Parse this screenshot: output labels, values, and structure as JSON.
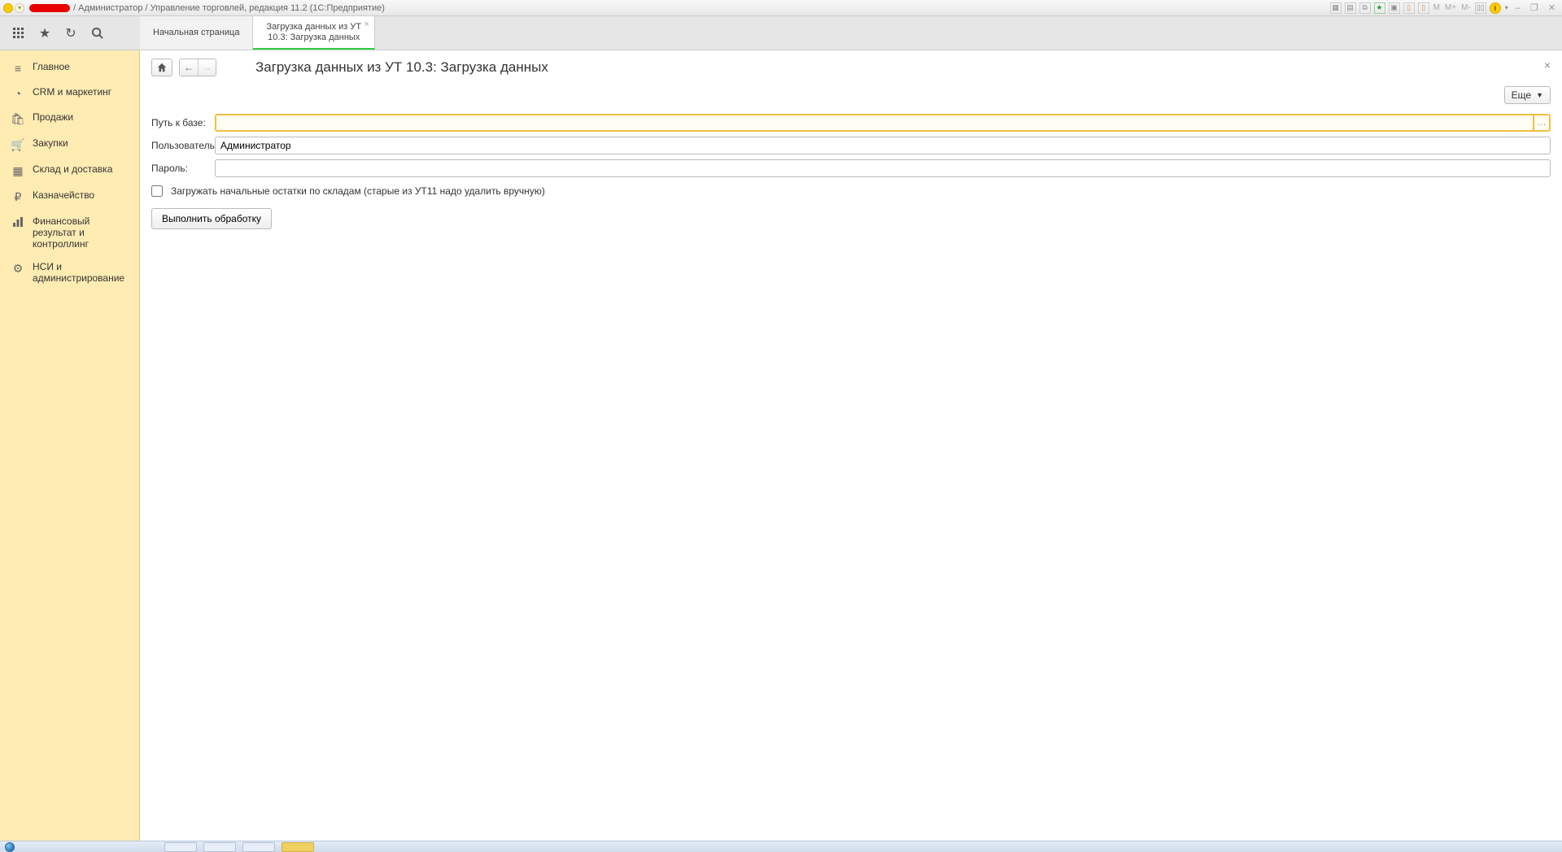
{
  "titlebar": {
    "text": "/ Администратор / Управление торговлей, редакция 11.2  (1С:Предприятие)",
    "m_labels": [
      "M",
      "M+",
      "M-"
    ]
  },
  "tabs": {
    "home": "Начальная страница",
    "active_line1": "Загрузка данных из УТ",
    "active_line2": "10.3: Загрузка данных"
  },
  "sidebar": {
    "items": [
      {
        "label": "Главное"
      },
      {
        "label": "CRM и маркетинг"
      },
      {
        "label": "Продажи"
      },
      {
        "label": "Закупки"
      },
      {
        "label": "Склад и доставка"
      },
      {
        "label": "Казначейство"
      },
      {
        "label": "Финансовый результат и контроллинг"
      },
      {
        "label": "НСИ и администрирование"
      }
    ]
  },
  "page": {
    "title": "Загрузка данных из УТ 10.3: Загрузка данных",
    "more_label": "Еще"
  },
  "form": {
    "path_label": "Путь к базе:",
    "path_value": "",
    "user_label": "Пользователь:",
    "user_value": "Администратор",
    "password_label": "Пароль:",
    "password_value": "",
    "checkbox_label": "Загружать начальные остатки по складам (старые из УТ11 надо удалить вручную)",
    "run_label": "Выполнить обработку"
  }
}
